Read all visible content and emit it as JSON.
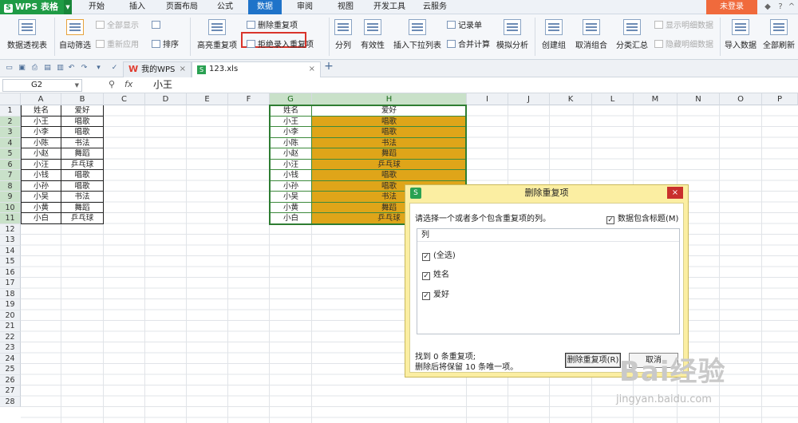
{
  "app": {
    "title": "WPS 表格"
  },
  "menu": {
    "tabs": [
      "开始",
      "插入",
      "页面布局",
      "公式",
      "数据",
      "审阅",
      "视图",
      "开发工具",
      "云服务"
    ],
    "active": "数据",
    "login": "未登录"
  },
  "ribbon": {
    "pivot": "数据透视表",
    "autofilter": "自动筛选",
    "show_all": "全部显示",
    "reapply": "重新应用",
    "sort": "排序",
    "highlight_dup": "高亮重复项",
    "remove_dup": "删除重复项",
    "reject_dup": "拒绝录入重复项",
    "split": "分列",
    "validation": "有效性",
    "insert_dropdown": "插入下拉列表",
    "record": "记录单",
    "consolidate": "合并计算",
    "whatif": "模拟分析",
    "group": "创建组",
    "ungroup": "取消组合",
    "subtotal": "分类汇总",
    "show_detail": "显示明细数据",
    "hide_detail": "隐藏明细数据",
    "import": "导入数据",
    "refresh_all": "全部刷新"
  },
  "tabs_bar": {
    "doc1": "我的WPS",
    "doc2": "123.xls",
    "add": "+"
  },
  "formula": {
    "cell_ref": "G2",
    "fx": "fx",
    "value": "小王"
  },
  "columns": [
    "A",
    "B",
    "C",
    "D",
    "E",
    "F",
    "G",
    "H",
    "I",
    "J",
    "K",
    "L",
    "M",
    "N",
    "O",
    "P"
  ],
  "rows": [
    "1",
    "2",
    "3",
    "4",
    "5",
    "6",
    "7",
    "8",
    "9",
    "10",
    "11",
    "12",
    "13",
    "14",
    "15",
    "16",
    "17",
    "18",
    "19",
    "20",
    "21",
    "22",
    "23",
    "24",
    "25",
    "26",
    "27",
    "28"
  ],
  "table_left": {
    "header": [
      "姓名",
      "爱好"
    ],
    "rows": [
      [
        "小王",
        "唱歌"
      ],
      [
        "小李",
        "唱歌"
      ],
      [
        "小陈",
        "书法"
      ],
      [
        "小赵",
        "舞蹈"
      ],
      [
        "小汪",
        "乒乓球"
      ],
      [
        "小钱",
        "唱歌"
      ],
      [
        "小孙",
        "唱歌"
      ],
      [
        "小吴",
        "书法"
      ],
      [
        "小黄",
        "舞蹈"
      ],
      [
        "小白",
        "乒乓球"
      ]
    ]
  },
  "table_right": {
    "header": [
      "姓名",
      "爱好"
    ],
    "rows": [
      [
        "小王",
        "唱歌"
      ],
      [
        "小李",
        "唱歌"
      ],
      [
        "小陈",
        "书法"
      ],
      [
        "小赵",
        "舞蹈"
      ],
      [
        "小汪",
        "乒乓球"
      ],
      [
        "小钱",
        "唱歌"
      ],
      [
        "小孙",
        "唱歌"
      ],
      [
        "小吴",
        "书法"
      ],
      [
        "小黄",
        "舞蹈"
      ],
      [
        "小白",
        "乒乓球"
      ]
    ]
  },
  "dialog": {
    "title": "删除重复项",
    "prompt": "请选择一个或者多个包含重复项的列。",
    "has_header": "数据包含标题(M)",
    "list_header": "列",
    "items": [
      "(全选)",
      "姓名",
      "爱好"
    ],
    "found": "找到 0 条重复项;",
    "keep": "删除后将保留 10 条唯一项。",
    "ok": "删除重复项(R)",
    "cancel": "取消"
  },
  "watermark": {
    "brand": "Bai经验",
    "url": "jingyan.baidu.com"
  },
  "colors": {
    "accent": "#1f73c9",
    "highlight_fill": "#dfa519",
    "dialog_bg": "#fbeea2",
    "app_green": "#1f9b45"
  }
}
